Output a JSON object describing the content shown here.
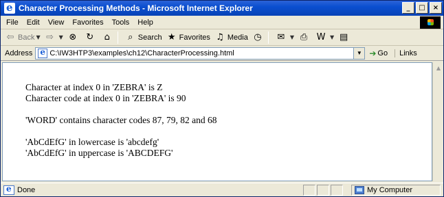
{
  "window": {
    "title": "Character Processing Methods - Microsoft Internet Explorer",
    "controls": {
      "minimize": "_",
      "maximize": "□",
      "close": "×"
    }
  },
  "menubar": {
    "items": [
      "File",
      "Edit",
      "View",
      "Favorites",
      "Tools",
      "Help"
    ]
  },
  "toolbar": {
    "back_label": "Back",
    "search_label": "Search",
    "favorites_label": "Favorites",
    "media_label": "Media",
    "icons": {
      "back": "back-arrow-icon",
      "forward": "forward-arrow-icon",
      "stop": "stop-icon",
      "refresh": "refresh-icon",
      "home": "home-icon",
      "search": "search-icon",
      "favorites": "favorites-icon",
      "media": "media-icon",
      "history": "history-icon",
      "mail": "mail-icon",
      "print": "print-icon",
      "edit": "word-edit-icon",
      "discuss": "discuss-icon"
    }
  },
  "addressbar": {
    "label": "Address",
    "url": "C:\\IW3HTP3\\examples\\ch12\\CharacterProcessing.html",
    "go_label": "Go",
    "links_label": "Links"
  },
  "content": {
    "lines": [
      "Character at index 0 in 'ZEBRA' is Z",
      "Character code at index 0 in 'ZEBRA' is 90",
      "'WORD' contains character codes 87, 79, 82 and 68",
      "'AbCdEfG' in lowercase is 'abcdefg'",
      "'AbCdEfG' in uppercase is 'ABCDEFG'"
    ]
  },
  "statusbar": {
    "status": "Done",
    "zone": "My Computer"
  },
  "colors": {
    "titlebar": "#0a4fd0",
    "chrome": "#ece9d8",
    "content_bg": "#ffffff"
  }
}
